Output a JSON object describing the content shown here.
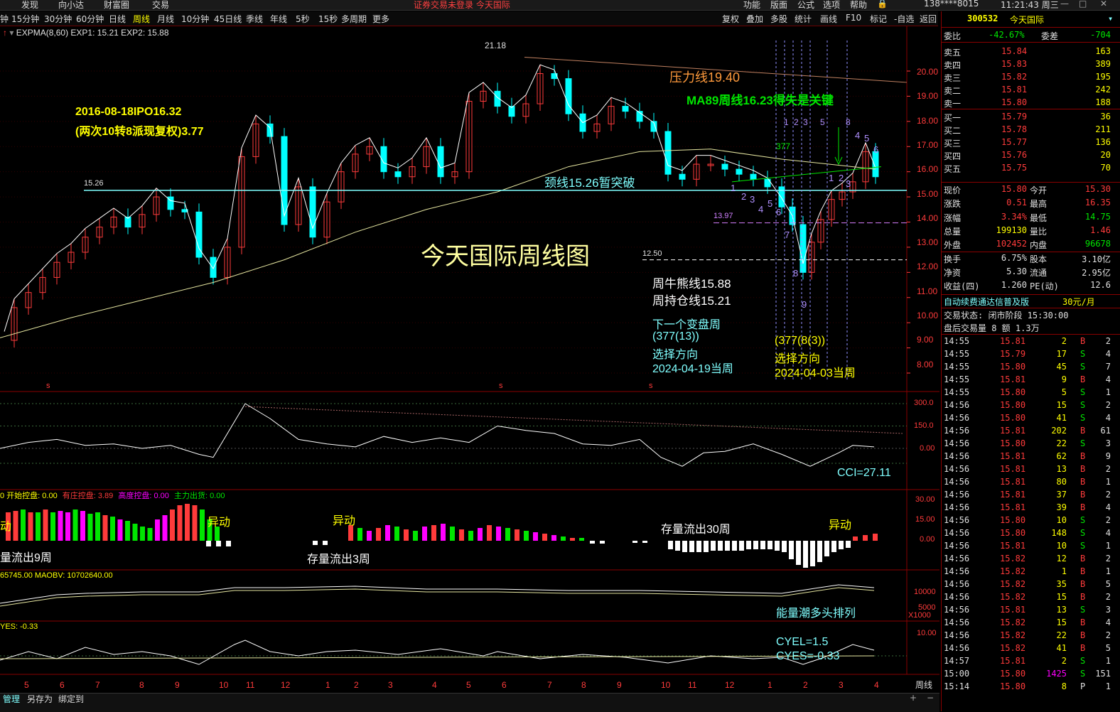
{
  "top_menu": {
    "items": [
      "发现",
      "向小达",
      "财富圈",
      "交易"
    ],
    "status": "证券交易未登录  今天国际",
    "right_items": [
      "功能",
      "版面",
      "公式",
      "选项",
      "帮助"
    ],
    "account": "138****8015",
    "clock": "11:21:43 周三"
  },
  "toolbar": {
    "periods": [
      "钟",
      "15分钟",
      "30分钟",
      "60分钟",
      "日线",
      "周线",
      "月线",
      "10分钟",
      "45日线",
      "季线",
      "年线",
      "5秒",
      "15秒",
      "多周期",
      "更多"
    ],
    "active_period": "周线",
    "right_buttons": [
      "复权",
      "叠加",
      "多股",
      "统计",
      "画线",
      "F10",
      "标记",
      "-自选",
      "返回"
    ]
  },
  "main_chart": {
    "indicator_line": "EXPMA(8,60)  EXP1: 15.21  EXP2: 15.88",
    "labels": {
      "high": "21.18",
      "neck_price": "15.26",
      "low_line": "13.97",
      "support": "12.50"
    },
    "annotations": {
      "ipo_line1": "2016-08-18IPO16.32",
      "ipo_line2": "(两次10转8派现复权)3.77",
      "pressure": "压力线19.40",
      "ma89": "MA89周线16.23得失是关键",
      "neck": "颈线15.26暂突破",
      "title": "今天国际周线图",
      "bull": "周牛熊线15.88",
      "hold": "周持仓线15.21",
      "next1": "下一个变盘周",
      "next2": "(377(13))",
      "next3": "选择方向",
      "next4": "2024-04-19当周",
      "cur1": "(377(8(3))",
      "cur2": "选择方向",
      "cur3": "2024-04-03当周",
      "fib377": "377"
    },
    "counts": [
      "1",
      "2",
      "3",
      "4",
      "5",
      "6",
      "7",
      "8",
      "9"
    ],
    "top_counts": [
      "1",
      "2",
      "3",
      "5",
      "8"
    ],
    "count2": [
      "1",
      "2",
      "3",
      "4",
      "5",
      "6"
    ],
    "yaxis": [
      "20.00",
      "19.00",
      "18.00",
      "17.00",
      "16.00",
      "15.00",
      "14.00",
      "13.00",
      "12.00",
      "11.00",
      "10.00",
      "9.00",
      "8.00"
    ],
    "s_marks": [
      "s",
      "s",
      "s"
    ]
  },
  "cci_panel": {
    "yaxis": [
      "300.0",
      "150.0",
      "0.00"
    ],
    "label": "CCI=27.11"
  },
  "vol_panel": {
    "legend": [
      {
        "text": "0  开始控盘: 0.00",
        "color": "#ffff00"
      },
      {
        "text": "有庄控盘: 3.89",
        "color": "#ff3b3b"
      },
      {
        "text": "高度控盘: 0.00",
        "color": "#ff00ff"
      },
      {
        "text": "主力出货: 0.00",
        "color": "#00e600"
      }
    ],
    "yaxis": [
      "30.00",
      "15.00",
      "0.00"
    ],
    "texts": [
      "动",
      "异动",
      "异动",
      "异动",
      "量流出9周",
      "存量流出3周",
      "存量流出30周"
    ]
  },
  "obv_panel": {
    "legend": "65745.00  MAOBV: 10702640.00",
    "yaxis": [
      "10000",
      "5000",
      "X1000"
    ],
    "label": "能量潮多头排列"
  },
  "cye_panel": {
    "legend": "YES: -0.33",
    "yaxis": [
      "10.00"
    ],
    "label1": "CYEL=1.5",
    "label2": "CYES=-0.33"
  },
  "xaxis": {
    "months": [
      "5",
      "6",
      "7",
      "8",
      "9",
      "10",
      "11",
      "12",
      "1",
      "2",
      "3",
      "4",
      "5",
      "6",
      "7",
      "8",
      "9",
      "10",
      "11",
      "12",
      "1",
      "2",
      "3",
      "4"
    ],
    "period_label": "周线"
  },
  "bottom_bar": {
    "tabs": [
      "管理",
      "另存为",
      "绑定到"
    ]
  },
  "quote": {
    "code": "300532",
    "name": "今天国际",
    "weibi_label": "委比",
    "weibi": "-42.67%",
    "weicha_label": "委差",
    "weicha": "-704",
    "sells": [
      {
        "label": "卖五",
        "price": "15.84",
        "vol": "163"
      },
      {
        "label": "卖四",
        "price": "15.83",
        "vol": "389"
      },
      {
        "label": "卖三",
        "price": "15.82",
        "vol": "195"
      },
      {
        "label": "卖二",
        "price": "15.81",
        "vol": "242"
      },
      {
        "label": "卖一",
        "price": "15.80",
        "vol": "188"
      }
    ],
    "buys": [
      {
        "label": "买一",
        "price": "15.79",
        "vol": "36"
      },
      {
        "label": "买二",
        "price": "15.78",
        "vol": "211"
      },
      {
        "label": "买三",
        "price": "15.77",
        "vol": "136"
      },
      {
        "label": "买四",
        "price": "15.76",
        "vol": "20"
      },
      {
        "label": "买五",
        "price": "15.75",
        "vol": "70"
      }
    ],
    "stats": [
      {
        "l1": "现价",
        "v1": "15.80",
        "c1": "red",
        "l2": "今开",
        "v2": "15.30",
        "c2": "red"
      },
      {
        "l1": "涨跌",
        "v1": "0.51",
        "c1": "red",
        "l2": "最高",
        "v2": "16.35",
        "c2": "red"
      },
      {
        "l1": "涨幅",
        "v1": "3.34%",
        "c1": "red",
        "l2": "最低",
        "v2": "14.75",
        "c2": "green"
      },
      {
        "l1": "总量",
        "v1": "199130",
        "c1": "yellow",
        "l2": "量比",
        "v2": "1.46",
        "c2": "red"
      },
      {
        "l1": "外盘",
        "v1": "102452",
        "c1": "red",
        "l2": "内盘",
        "v2": "96678",
        "c2": "green"
      },
      {
        "l1": "换手",
        "v1": "6.75%",
        "c1": "white",
        "l2": "股本",
        "v2": "3.10亿",
        "c2": "white"
      },
      {
        "l1": "净资",
        "v1": "5.30",
        "c1": "white",
        "l2": "流通",
        "v2": "2.95亿",
        "c2": "white"
      },
      {
        "l1": "收益(四)",
        "v1": "1.260",
        "c1": "white",
        "l2": "PE(动)",
        "v2": "12.6",
        "c2": "white"
      }
    ],
    "promo": "自动续费通达信普及版",
    "promo_price": "30元/月",
    "trade_state": "交易状态: 闭市阶段 15:30:00",
    "after_hours": "盘后交易量 8 额 1.3万",
    "ticks": [
      {
        "t": "14:55",
        "p": "15.81",
        "v": "2",
        "d": "B",
        "n": "2"
      },
      {
        "t": "14:55",
        "p": "15.79",
        "v": "17",
        "d": "S",
        "n": "4"
      },
      {
        "t": "14:55",
        "p": "15.80",
        "v": "45",
        "d": "S",
        "n": "7"
      },
      {
        "t": "14:55",
        "p": "15.81",
        "v": "9",
        "d": "B",
        "n": "4"
      },
      {
        "t": "14:55",
        "p": "15.80",
        "v": "5",
        "d": "S",
        "n": "1"
      },
      {
        "t": "14:56",
        "p": "15.80",
        "v": "15",
        "d": "S",
        "n": "2"
      },
      {
        "t": "14:56",
        "p": "15.80",
        "v": "41",
        "d": "S",
        "n": "4"
      },
      {
        "t": "14:56",
        "p": "15.81",
        "v": "202",
        "d": "B",
        "n": "61"
      },
      {
        "t": "14:56",
        "p": "15.80",
        "v": "22",
        "d": "S",
        "n": "3"
      },
      {
        "t": "14:56",
        "p": "15.81",
        "v": "62",
        "d": "B",
        "n": "9"
      },
      {
        "t": "14:56",
        "p": "15.81",
        "v": "13",
        "d": "B",
        "n": "2"
      },
      {
        "t": "14:56",
        "p": "15.81",
        "v": "80",
        "d": "B",
        "n": "1"
      },
      {
        "t": "14:56",
        "p": "15.81",
        "v": "37",
        "d": "B",
        "n": "2"
      },
      {
        "t": "14:56",
        "p": "15.81",
        "v": "39",
        "d": "B",
        "n": "4"
      },
      {
        "t": "14:56",
        "p": "15.80",
        "v": "10",
        "d": "S",
        "n": "2"
      },
      {
        "t": "14:56",
        "p": "15.80",
        "v": "148",
        "d": "S",
        "n": "4"
      },
      {
        "t": "14:56",
        "p": "15.81",
        "v": "10",
        "d": "S",
        "n": "1"
      },
      {
        "t": "14:56",
        "p": "15.82",
        "v": "12",
        "d": "B",
        "n": "2"
      },
      {
        "t": "14:56",
        "p": "15.82",
        "v": "1",
        "d": "B",
        "n": "1"
      },
      {
        "t": "14:56",
        "p": "15.82",
        "v": "35",
        "d": "B",
        "n": "5"
      },
      {
        "t": "14:56",
        "p": "15.82",
        "v": "15",
        "d": "B",
        "n": "2"
      },
      {
        "t": "14:56",
        "p": "15.81",
        "v": "13",
        "d": "S",
        "n": "3"
      },
      {
        "t": "14:56",
        "p": "15.82",
        "v": "15",
        "d": "B",
        "n": "4"
      },
      {
        "t": "14:56",
        "p": "15.82",
        "v": "22",
        "d": "B",
        "n": "2"
      },
      {
        "t": "14:56",
        "p": "15.82",
        "v": "41",
        "d": "B",
        "n": "5"
      },
      {
        "t": "14:57",
        "p": "15.81",
        "v": "2",
        "d": "S",
        "n": "1"
      },
      {
        "t": "15:00",
        "p": "15.80",
        "v": "1425",
        "d": "S",
        "n": "151"
      },
      {
        "t": "15:14",
        "p": "15.80",
        "v": "8",
        "d": "P",
        "n": "1"
      }
    ]
  },
  "colors": {
    "up": "#ff3b3b",
    "down": "#00ffff",
    "ma": "#ffffff",
    "ma2": "#e6e6a0",
    "neck": "#80ffff",
    "panel_border": "#8a0000"
  }
}
